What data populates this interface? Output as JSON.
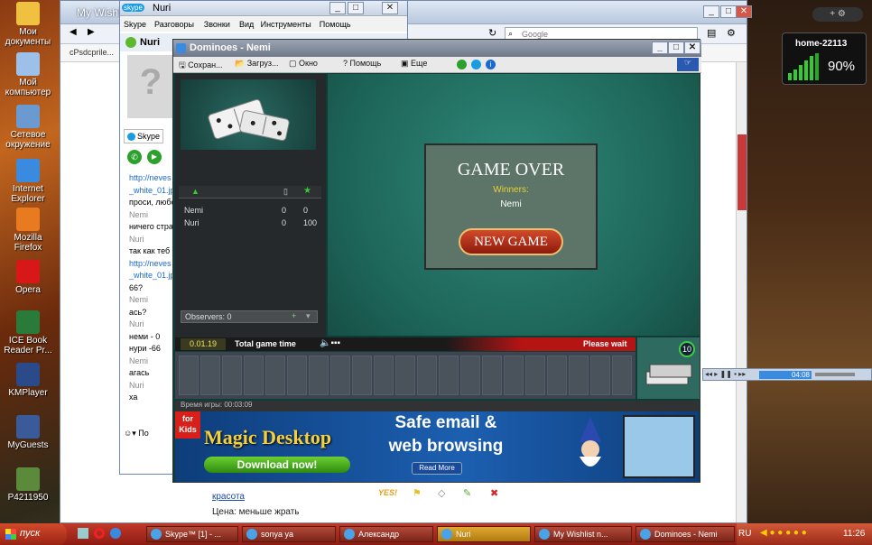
{
  "desktop": {
    "icons": [
      {
        "label": "Мои документы",
        "color": "#f0c040"
      },
      {
        "label": "Мой компьютер",
        "color": "#9cc0e8"
      },
      {
        "label": "Сетевое окружение",
        "color": "#6a9ad0"
      },
      {
        "label": "Internet Explorer",
        "color": "#3a8ae0"
      },
      {
        "label": "Mozilla Firefox",
        "color": "#e87a20"
      },
      {
        "label": "Opera",
        "color": "#d81818"
      },
      {
        "label": "ICE Book Reader Pr...",
        "color": "#2a7a3a"
      },
      {
        "label": "KMPlayer",
        "color": "#2a4a8a"
      },
      {
        "label": "MyGuests",
        "color": "#3a5a9a"
      },
      {
        "label": "P4211950",
        "color": "#5a8a3a"
      }
    ]
  },
  "gadget": {
    "name": "home-22113",
    "percent": "90%"
  },
  "browser": {
    "tab": "My Wishl",
    "search_placeholder": "Google",
    "addr": "сРsdсрrile...",
    "bottom_links": [
      "красота",
      "Цена: меньше жрать"
    ],
    "action_icons": [
      "yes-icon",
      "flag-icon",
      "diamond-icon",
      "pencil-icon",
      "delete-icon"
    ],
    "yes_label": "YES!"
  },
  "skype": {
    "title": "Nuri",
    "menu": [
      "Skype",
      "Разговоры",
      "Звонки",
      "Вид",
      "Инструменты",
      "Помощь"
    ],
    "contact": "Nuri",
    "tab": "Skype",
    "chat": [
      {
        "t": "http://neves",
        "link": true
      },
      {
        "t": "_white_01.jp",
        "link": true
      },
      {
        "t": "проси, любо"
      },
      {
        "t": "Nemi",
        "name": true
      },
      {
        "t": "ничего стра"
      },
      {
        "t": "Nuri",
        "name": true
      },
      {
        "t": "так как теб"
      },
      {
        "t": "http://neves",
        "link": true
      },
      {
        "t": "_white_01.jp",
        "link": true
      },
      {
        "t": "66?"
      },
      {
        "t": "Nemi",
        "name": true
      },
      {
        "t": "ась?"
      },
      {
        "t": "Nuri",
        "name": true
      },
      {
        "t": "неми - 0"
      },
      {
        "t": "нури -66"
      },
      {
        "t": "Nemi",
        "name": true
      },
      {
        "t": "агась"
      },
      {
        "t": "Nuri",
        "name": true
      },
      {
        "t": "ха"
      }
    ],
    "bottom": "По"
  },
  "dominoes": {
    "title": "Dominoes - Nemi",
    "toolbar": [
      "Сохран...",
      "Загруз...",
      "Окно",
      "Помощь",
      "Еще"
    ],
    "players": [
      {
        "name": "Nemi",
        "a": "0",
        "b": "0"
      },
      {
        "name": "Nuri",
        "a": "0",
        "b": "100"
      }
    ],
    "observers_label": "Observers:",
    "observers": "0",
    "game_over": "GAME OVER",
    "winners_label": "Winners:",
    "winner": "Nemi",
    "new_game": "NEW GAME",
    "time": "0.01.19",
    "total_label": "Total game time",
    "please_wait": "Please wait",
    "boneyard_count": "10",
    "status": "Время игры: 00:03:09"
  },
  "ad": {
    "badge": "for Kids",
    "brand": "Magic Desktop",
    "download": "Download now!",
    "line1": "Safe email &",
    "line2": "web browsing",
    "read_more": "Read More"
  },
  "player_bar": {
    "time": "04:08"
  },
  "taskbar": {
    "start": "пуск",
    "tasks": [
      {
        "label": "Skype™ [1] - ..."
      },
      {
        "label": "sonya ya"
      },
      {
        "label": "Александр"
      },
      {
        "label": "Nuri",
        "active": true
      },
      {
        "label": "My Wishlist n..."
      },
      {
        "label": "Dominoes - Nemi"
      }
    ],
    "lang": "RU",
    "clock": "11:26"
  }
}
